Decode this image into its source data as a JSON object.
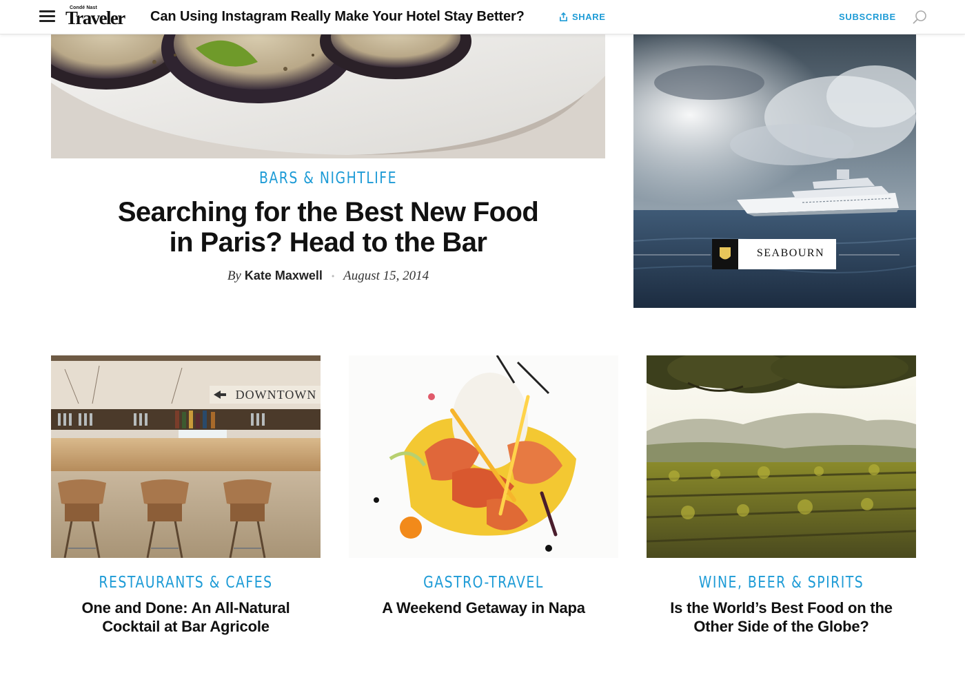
{
  "header": {
    "logo_small": "Condé Nast",
    "logo_big": "Traveler",
    "headline": "Can Using Instagram Really Make Your Hotel Stay Better?",
    "share_label": "SHARE",
    "subscribe_label": "SUBSCRIBE",
    "icons": [
      "menu-icon",
      "share-icon",
      "search-icon"
    ]
  },
  "featured": {
    "category": "BARS & NIGHTLIFE",
    "title_line1": "Searching for the Best New Food",
    "title_line2": "in Paris? Head to the Bar",
    "byline_prefix": "By",
    "author": "Kate Maxwell",
    "date": "August 15, 2014"
  },
  "ad": {
    "brand": "SEABOURN"
  },
  "cards": [
    {
      "category": "RESTAURANTS & CAFES",
      "title_line1": "One and Done: An All-Natural",
      "title_line2": "Cocktail at Bar Agricole",
      "sign_text": "DOWNTOWN"
    },
    {
      "category": "GASTRO-TRAVEL",
      "title_line1": "A Weekend Getaway in Napa",
      "title_line2": ""
    },
    {
      "category": "WINE, BEER & SPIRITS",
      "title_line1": "Is the World’s Best Food on the",
      "title_line2": "Other Side of the Globe?"
    }
  ],
  "colors": {
    "accent": "#1d9bd6",
    "text": "#111111"
  }
}
